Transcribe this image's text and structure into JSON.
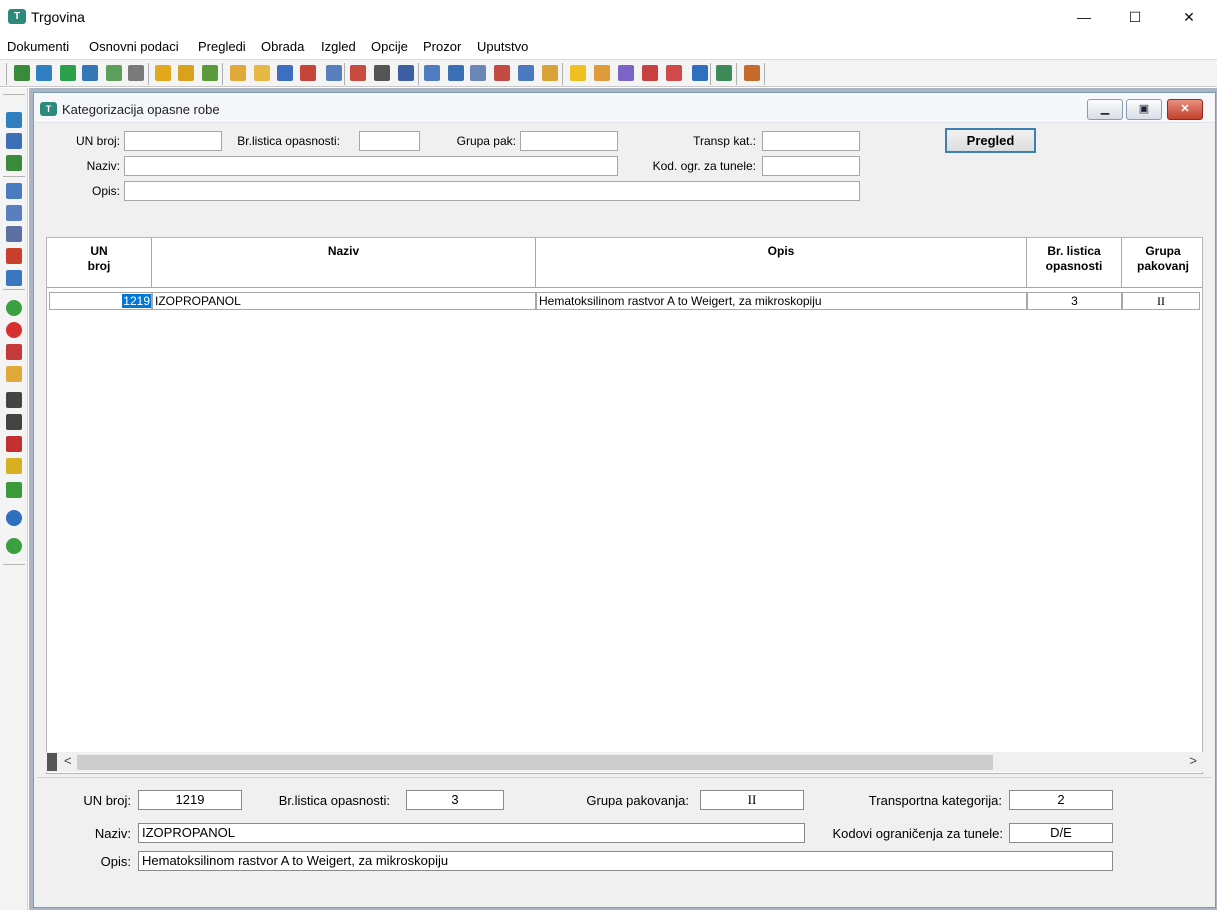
{
  "app": {
    "title": "Trgovina",
    "logo_text": "T"
  },
  "window_controls": {
    "minimize": "—",
    "maximize": "☐",
    "close": "✕"
  },
  "menu": [
    "Dokumenti",
    "Osnovni podaci",
    "Pregledi",
    "Obrada",
    "Izgled",
    "Opcije",
    "Prozor",
    "Uputstvo"
  ],
  "child": {
    "title": "Kategorizacija opasne robe",
    "logo_text": "T",
    "controls": {
      "minimize": "▁",
      "restore": "▣",
      "close": "✕"
    }
  },
  "filter": {
    "un_label": "UN broj:",
    "un_value": "",
    "brlist_label": "Br.listica opasnosti:",
    "brlist_value": "",
    "grupa_label": "Grupa pak:",
    "grupa_value": "",
    "transp_label": "Transp kat.:",
    "transp_value": "",
    "naziv_label": "Naziv:",
    "naziv_value": "",
    "kod_label": "Kod. ogr. za tunele:",
    "kod_value": "",
    "opis_label": "Opis:",
    "opis_value": "",
    "pregled_button": "Pregled"
  },
  "grid": {
    "headers": {
      "un": "UN broj",
      "naziv": "Naziv",
      "opis": "Opis",
      "brlist": "Br. listica opasnosti",
      "grupa": "Grupa pakovanj"
    },
    "rows": [
      {
        "un": "1219",
        "naziv": "IZOPROPANOL",
        "opis": "Hematoksilinom rastvor A to Weigert, za mikroskopiju",
        "brlist": "3",
        "grupa": "II"
      }
    ],
    "scroll": {
      "left": "<",
      "right": ">"
    }
  },
  "detail": {
    "un_label": "UN broj:",
    "un_value": "1219",
    "brlist_label": "Br.listica opasnosti:",
    "brlist_value": "3",
    "grupa_label": "Grupa pakovanja:",
    "grupa_value": "II",
    "transp_label": "Transportna kategorija:",
    "transp_value": "2",
    "naziv_label": "Naziv:",
    "naziv_value": "IZOPROPANOL",
    "kod_label": "Kodovi ograničenja za tunele:",
    "kod_value": "D/E",
    "opis_label": "Opis:",
    "opis_value": "Hematoksilinom rastvor A to Weigert, za mikroskopiju"
  },
  "toolbar_icons": [
    "record-1-icon",
    "import-icon",
    "refresh-icon",
    "export-icon",
    "export-doc-icon",
    "calculator-icon",
    "folder-in-icon",
    "folder-out-icon",
    "folder-up-icon",
    "envelope-icon",
    "note-icon",
    "card-icon",
    "card-red-icon",
    "list-icon",
    "list-red-icon",
    "sum-icon",
    "calendar-icon",
    "layout-icon",
    "table-icon",
    "copy-icon",
    "report-red-icon",
    "report-icon",
    "report-yellow-icon",
    "bulb-icon",
    "tag-icon",
    "gear-icon",
    "dollar-icon",
    "gem-icon",
    "help-icon",
    "chart-icon",
    "exit-icon"
  ],
  "left_icons": [
    "save-icon",
    "save-as-icon",
    "export-table-icon",
    "print-icon",
    "print-preview-icon",
    "link-icon",
    "box-red-icon",
    "box-blue-icon",
    "add-icon",
    "delete-icon",
    "undo-icon",
    "edit-icon",
    "find-icon",
    "find-next-icon",
    "sort-icon",
    "filter-icon",
    "expand-icon",
    "help-icon",
    "add-circle-icon"
  ],
  "colors": {
    "accent": "#2c8a7a",
    "selection": "#0078d7",
    "focus_border": "#3c7fb1"
  }
}
